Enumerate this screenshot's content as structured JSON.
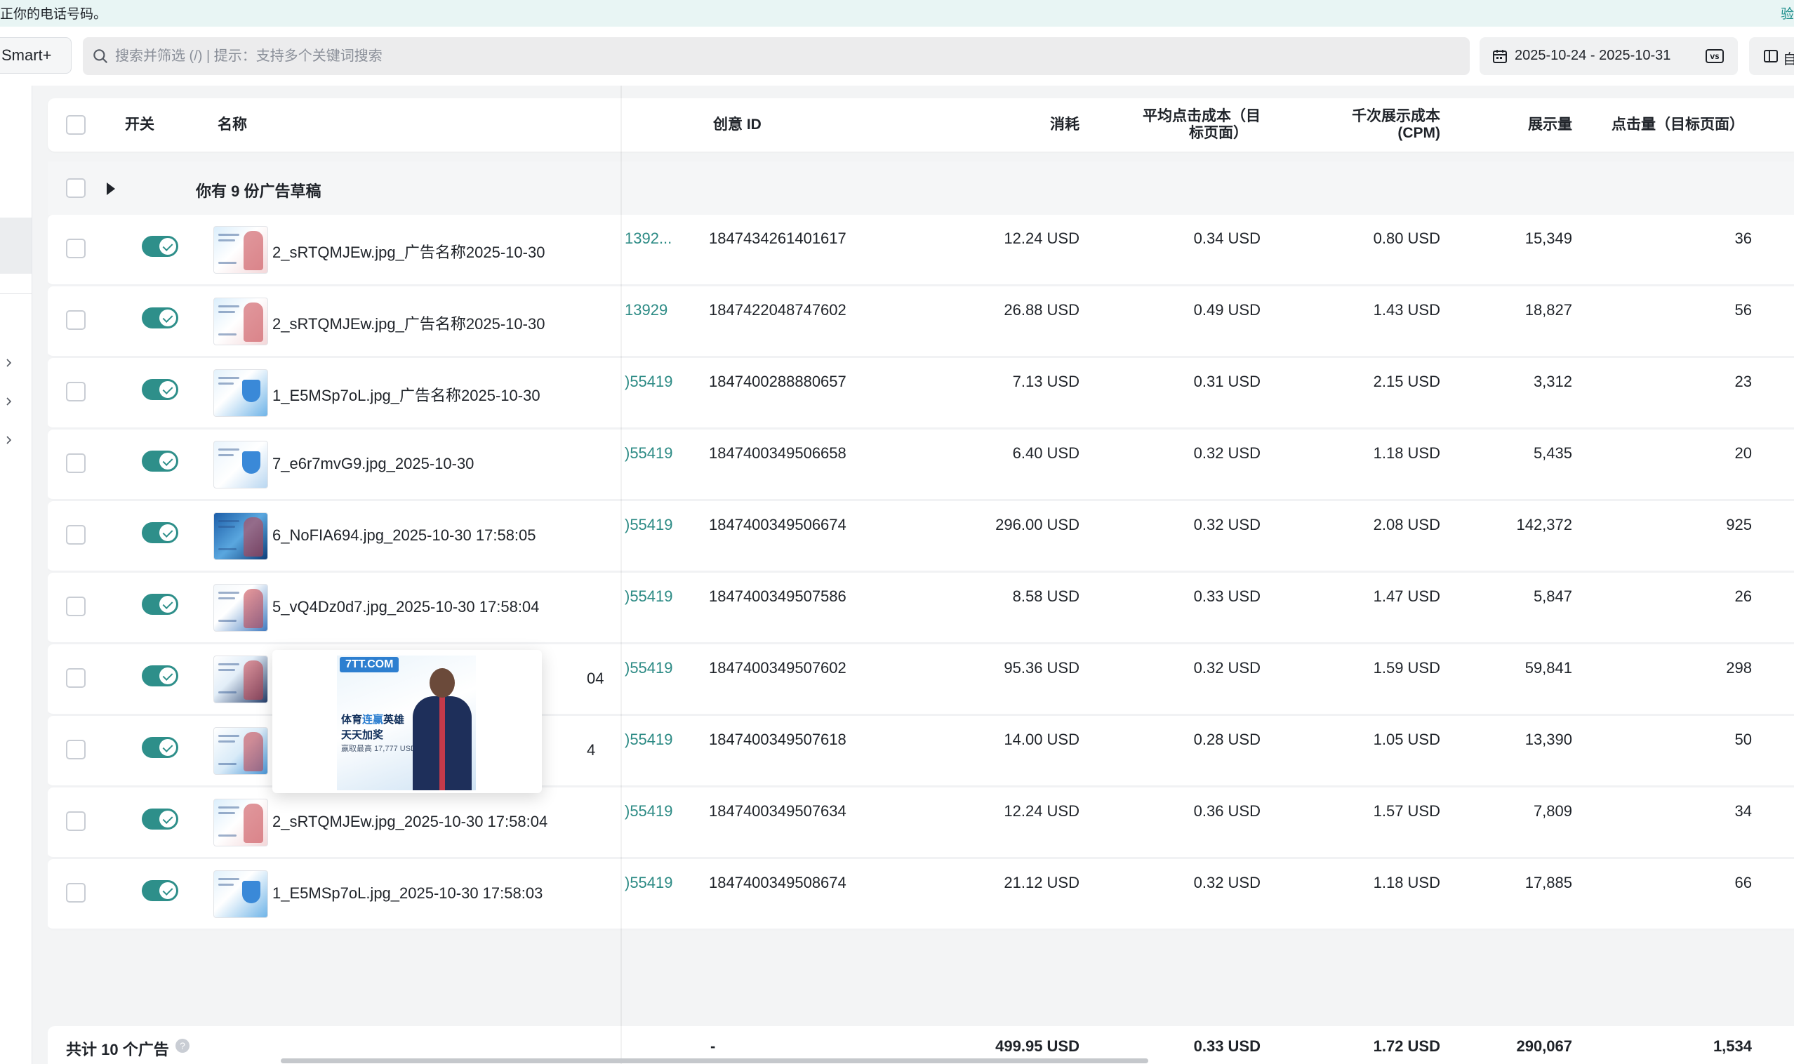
{
  "banner": {
    "message": "正你的电话号码。",
    "verify": "验"
  },
  "toolbar": {
    "smart_label": "Smart+",
    "search_placeholder": "搜索并筛选 (/) | 提示：支持多个关键词搜索",
    "date_range": "2025-10-24 - 2025-10-31",
    "columns_label": "自"
  },
  "table": {
    "headers": {
      "toggle": "开关",
      "name": "名称",
      "creative_id": "创意 ID",
      "spend": "消耗",
      "cpc_line1": "平均点击成本（目",
      "cpc_line2": "标页面）",
      "cpm_line1": "千次展示成本",
      "cpm_line2": "(CPM)",
      "impressions": "展示量",
      "clicks": "点击量（目标页面）"
    },
    "draft_label": "你有 9 份广告草稿",
    "rows": [
      {
        "name": "2_sRTQMJEw.jpg_广告名称2025-10-30",
        "ref": "1392...",
        "creative_id": "1847434261401617",
        "spend": "12.24 USD",
        "cpc": "0.34 USD",
        "cpm": "0.80 USD",
        "impressions": "15,349",
        "clicks": "36"
      },
      {
        "name": "2_sRTQMJEw.jpg_广告名称2025-10-30",
        "ref": "13929",
        "creative_id": "1847422048747602",
        "spend": "26.88 USD",
        "cpc": "0.49 USD",
        "cpm": "1.43 USD",
        "impressions": "18,827",
        "clicks": "56"
      },
      {
        "name": "1_E5MSp7oL.jpg_广告名称2025-10-30",
        "ref": ")55419",
        "creative_id": "1847400288880657",
        "spend": "7.13 USD",
        "cpc": "0.31 USD",
        "cpm": "2.15 USD",
        "impressions": "3,312",
        "clicks": "23"
      },
      {
        "name": "7_e6r7mvG9.jpg_2025-10-30",
        "ref": ")55419",
        "creative_id": "1847400349506658",
        "spend": "6.40 USD",
        "cpc": "0.32 USD",
        "cpm": "1.18 USD",
        "impressions": "5,435",
        "clicks": "20"
      },
      {
        "name": "6_NoFIA694.jpg_2025-10-30 17:58:05",
        "ref": ")55419",
        "creative_id": "1847400349506674",
        "spend": "296.00 USD",
        "cpc": "0.32 USD",
        "cpm": "2.08 USD",
        "impressions": "142,372",
        "clicks": "925"
      },
      {
        "name": "5_vQ4Dz0d7.jpg_2025-10-30 17:58:04",
        "ref": ")55419",
        "creative_id": "1847400349507586",
        "spend": "8.58 USD",
        "cpc": "0.33 USD",
        "cpm": "1.47 USD",
        "impressions": "5,847",
        "clicks": "26"
      },
      {
        "name": "04",
        "ref": ")55419",
        "creative_id": "1847400349507602",
        "spend": "95.36 USD",
        "cpc": "0.32 USD",
        "cpm": "1.59 USD",
        "impressions": "59,841",
        "clicks": "298"
      },
      {
        "name": "4",
        "ref": ")55419",
        "creative_id": "1847400349507618",
        "spend": "14.00 USD",
        "cpc": "0.28 USD",
        "cpm": "1.05 USD",
        "impressions": "13,390",
        "clicks": "50"
      },
      {
        "name": "2_sRTQMJEw.jpg_2025-10-30 17:58:04",
        "ref": ")55419",
        "creative_id": "1847400349507634",
        "spend": "12.24 USD",
        "cpc": "0.36 USD",
        "cpm": "1.57 USD",
        "impressions": "7,809",
        "clicks": "34"
      },
      {
        "name": "1_E5MSp7oL.jpg_2025-10-30 17:58:03",
        "ref": ")55419",
        "creative_id": "1847400349508674",
        "spend": "21.12 USD",
        "cpc": "0.32 USD",
        "cpm": "1.18 USD",
        "impressions": "17,885",
        "clicks": "66"
      }
    ],
    "footer": {
      "total_label": "共计 10 个广告",
      "help_glyph": "?",
      "creative_id": "-",
      "spend": "499.95 USD",
      "cpc": "0.33 USD",
      "cpm": "1.72 USD",
      "impressions": "290,067",
      "clicks": "1,534"
    }
  },
  "popover": {
    "brand": "7TT.COM",
    "headline_prefix": "体育",
    "headline_highlight": "连赢",
    "headline_suffix": "英雄",
    "headline2": "天天加奖",
    "sub": "赢取最高 17,777 USD"
  },
  "colors": {
    "accent": "#2e8f8a",
    "link": "#2b8a84",
    "banner_bg": "#e8f5f4"
  },
  "icons": {
    "search": "search-icon",
    "calendar": "calendar-icon",
    "compare": "vs-icon",
    "columns": "columns-icon",
    "expand": "caret-right-icon",
    "nav_chevron": "chevron-right-icon"
  }
}
